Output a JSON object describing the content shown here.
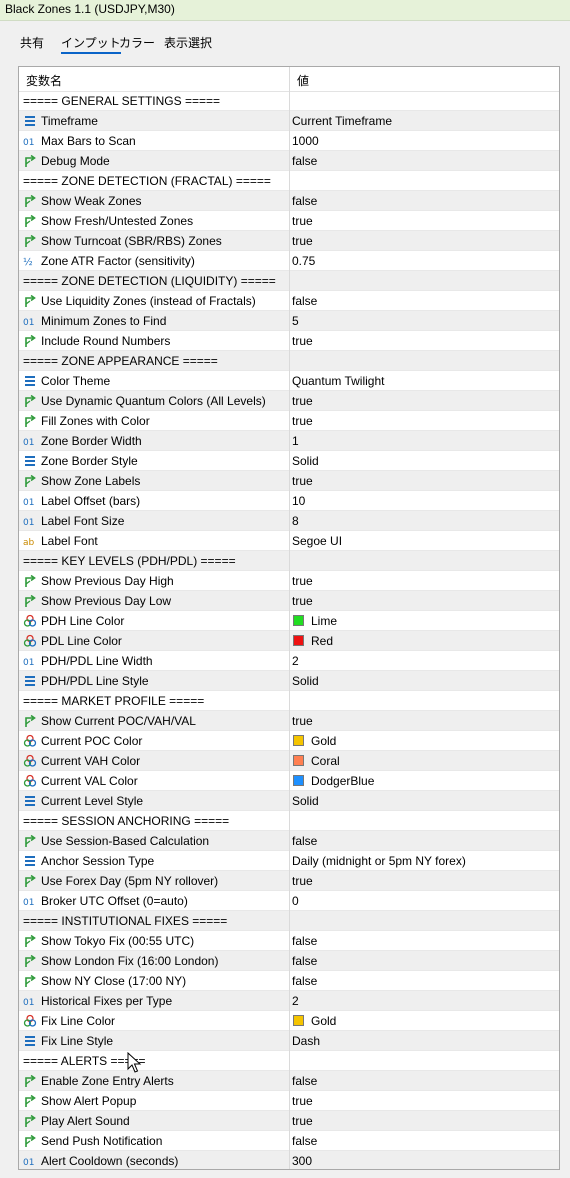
{
  "window": {
    "title": "Black Zones 1.1 (USDJPY,M30)"
  },
  "tabs": [
    {
      "label": "共有"
    },
    {
      "label": "インプット",
      "active": true
    },
    {
      "label": "カラー"
    },
    {
      "label": "表示選択"
    }
  ],
  "columns": {
    "name": "変数名",
    "value": "値"
  },
  "rows": [
    {
      "type": "section",
      "name": "===== GENERAL SETTINGS ====="
    },
    {
      "type": "enum",
      "name": "Timeframe",
      "value": "Current Timeframe"
    },
    {
      "type": "int",
      "name": "Max Bars to Scan",
      "value": "1000"
    },
    {
      "type": "bool",
      "name": "Debug Mode",
      "value": "false"
    },
    {
      "type": "section",
      "name": "===== ZONE DETECTION (FRACTAL) ====="
    },
    {
      "type": "bool",
      "name": "Show Weak Zones",
      "value": "false"
    },
    {
      "type": "bool",
      "name": "Show Fresh/Untested Zones",
      "value": "true"
    },
    {
      "type": "bool",
      "name": "Show Turncoat (SBR/RBS) Zones",
      "value": "true"
    },
    {
      "type": "double",
      "name": "Zone ATR Factor (sensitivity)",
      "value": "0.75"
    },
    {
      "type": "section",
      "name": "===== ZONE DETECTION (LIQUIDITY) ====="
    },
    {
      "type": "bool",
      "name": "Use Liquidity Zones (instead of Fractals)",
      "value": "false"
    },
    {
      "type": "int",
      "name": "Minimum Zones to Find",
      "value": "5"
    },
    {
      "type": "bool",
      "name": "Include Round Numbers",
      "value": "true"
    },
    {
      "type": "section",
      "name": "===== ZONE APPEARANCE ====="
    },
    {
      "type": "enum",
      "name": "Color Theme",
      "value": "Quantum Twilight"
    },
    {
      "type": "bool",
      "name": "Use Dynamic Quantum Colors (All Levels)",
      "value": "true"
    },
    {
      "type": "bool",
      "name": "Fill Zones with Color",
      "value": "true"
    },
    {
      "type": "int",
      "name": "Zone Border Width",
      "value": "1"
    },
    {
      "type": "enum",
      "name": "Zone Border Style",
      "value": "Solid"
    },
    {
      "type": "bool",
      "name": "Show Zone Labels",
      "value": "true"
    },
    {
      "type": "int",
      "name": "Label Offset (bars)",
      "value": "10"
    },
    {
      "type": "int",
      "name": "Label Font Size",
      "value": "8"
    },
    {
      "type": "string",
      "name": "Label Font",
      "value": "Segoe UI"
    },
    {
      "type": "section",
      "name": "===== KEY LEVELS (PDH/PDL) ====="
    },
    {
      "type": "bool",
      "name": "Show Previous Day High",
      "value": "true"
    },
    {
      "type": "bool",
      "name": "Show Previous Day Low",
      "value": "true"
    },
    {
      "type": "color",
      "name": "PDH Line Color",
      "value": "Lime",
      "swatch": "#22dd22"
    },
    {
      "type": "color",
      "name": "PDL Line Color",
      "value": "Red",
      "swatch": "#ee1111"
    },
    {
      "type": "int",
      "name": "PDH/PDL Line Width",
      "value": "2"
    },
    {
      "type": "enum",
      "name": "PDH/PDL Line Style",
      "value": "Solid"
    },
    {
      "type": "section",
      "name": "===== MARKET PROFILE ====="
    },
    {
      "type": "bool",
      "name": "Show Current POC/VAH/VAL",
      "value": "true"
    },
    {
      "type": "color",
      "name": "Current POC Color",
      "value": "Gold",
      "swatch": "#f5c400"
    },
    {
      "type": "color",
      "name": "Current VAH Color",
      "value": "Coral",
      "swatch": "#ff7f50"
    },
    {
      "type": "color",
      "name": "Current VAL Color",
      "value": "DodgerBlue",
      "swatch": "#1e90ff"
    },
    {
      "type": "enum",
      "name": "Current Level Style",
      "value": "Solid"
    },
    {
      "type": "section",
      "name": "===== SESSION ANCHORING ====="
    },
    {
      "type": "bool",
      "name": "Use Session-Based Calculation",
      "value": "false"
    },
    {
      "type": "enum",
      "name": "Anchor Session Type",
      "value": "Daily (midnight or 5pm NY forex)"
    },
    {
      "type": "bool",
      "name": "Use Forex Day (5pm NY rollover)",
      "value": "true"
    },
    {
      "type": "int",
      "name": "Broker UTC Offset (0=auto)",
      "value": "0"
    },
    {
      "type": "section",
      "name": "===== INSTITUTIONAL FIXES ====="
    },
    {
      "type": "bool",
      "name": "Show Tokyo Fix (00:55 UTC)",
      "value": "false"
    },
    {
      "type": "bool",
      "name": "Show London Fix (16:00 London)",
      "value": "false"
    },
    {
      "type": "bool",
      "name": "Show NY Close (17:00 NY)",
      "value": "false"
    },
    {
      "type": "int",
      "name": "Historical Fixes per Type",
      "value": "2"
    },
    {
      "type": "color",
      "name": "Fix Line Color",
      "value": "Gold",
      "swatch": "#f5c400"
    },
    {
      "type": "enum",
      "name": "Fix Line Style",
      "value": "Dash"
    },
    {
      "type": "section",
      "name": "===== ALERTS ====="
    },
    {
      "type": "bool",
      "name": "Enable Zone Entry Alerts",
      "value": "false"
    },
    {
      "type": "bool",
      "name": "Show Alert Popup",
      "value": "true"
    },
    {
      "type": "bool",
      "name": "Play Alert Sound",
      "value": "true"
    },
    {
      "type": "bool",
      "name": "Send Push Notification",
      "value": "false"
    },
    {
      "type": "int",
      "name": "Alert Cooldown (seconds)",
      "value": "300"
    }
  ]
}
